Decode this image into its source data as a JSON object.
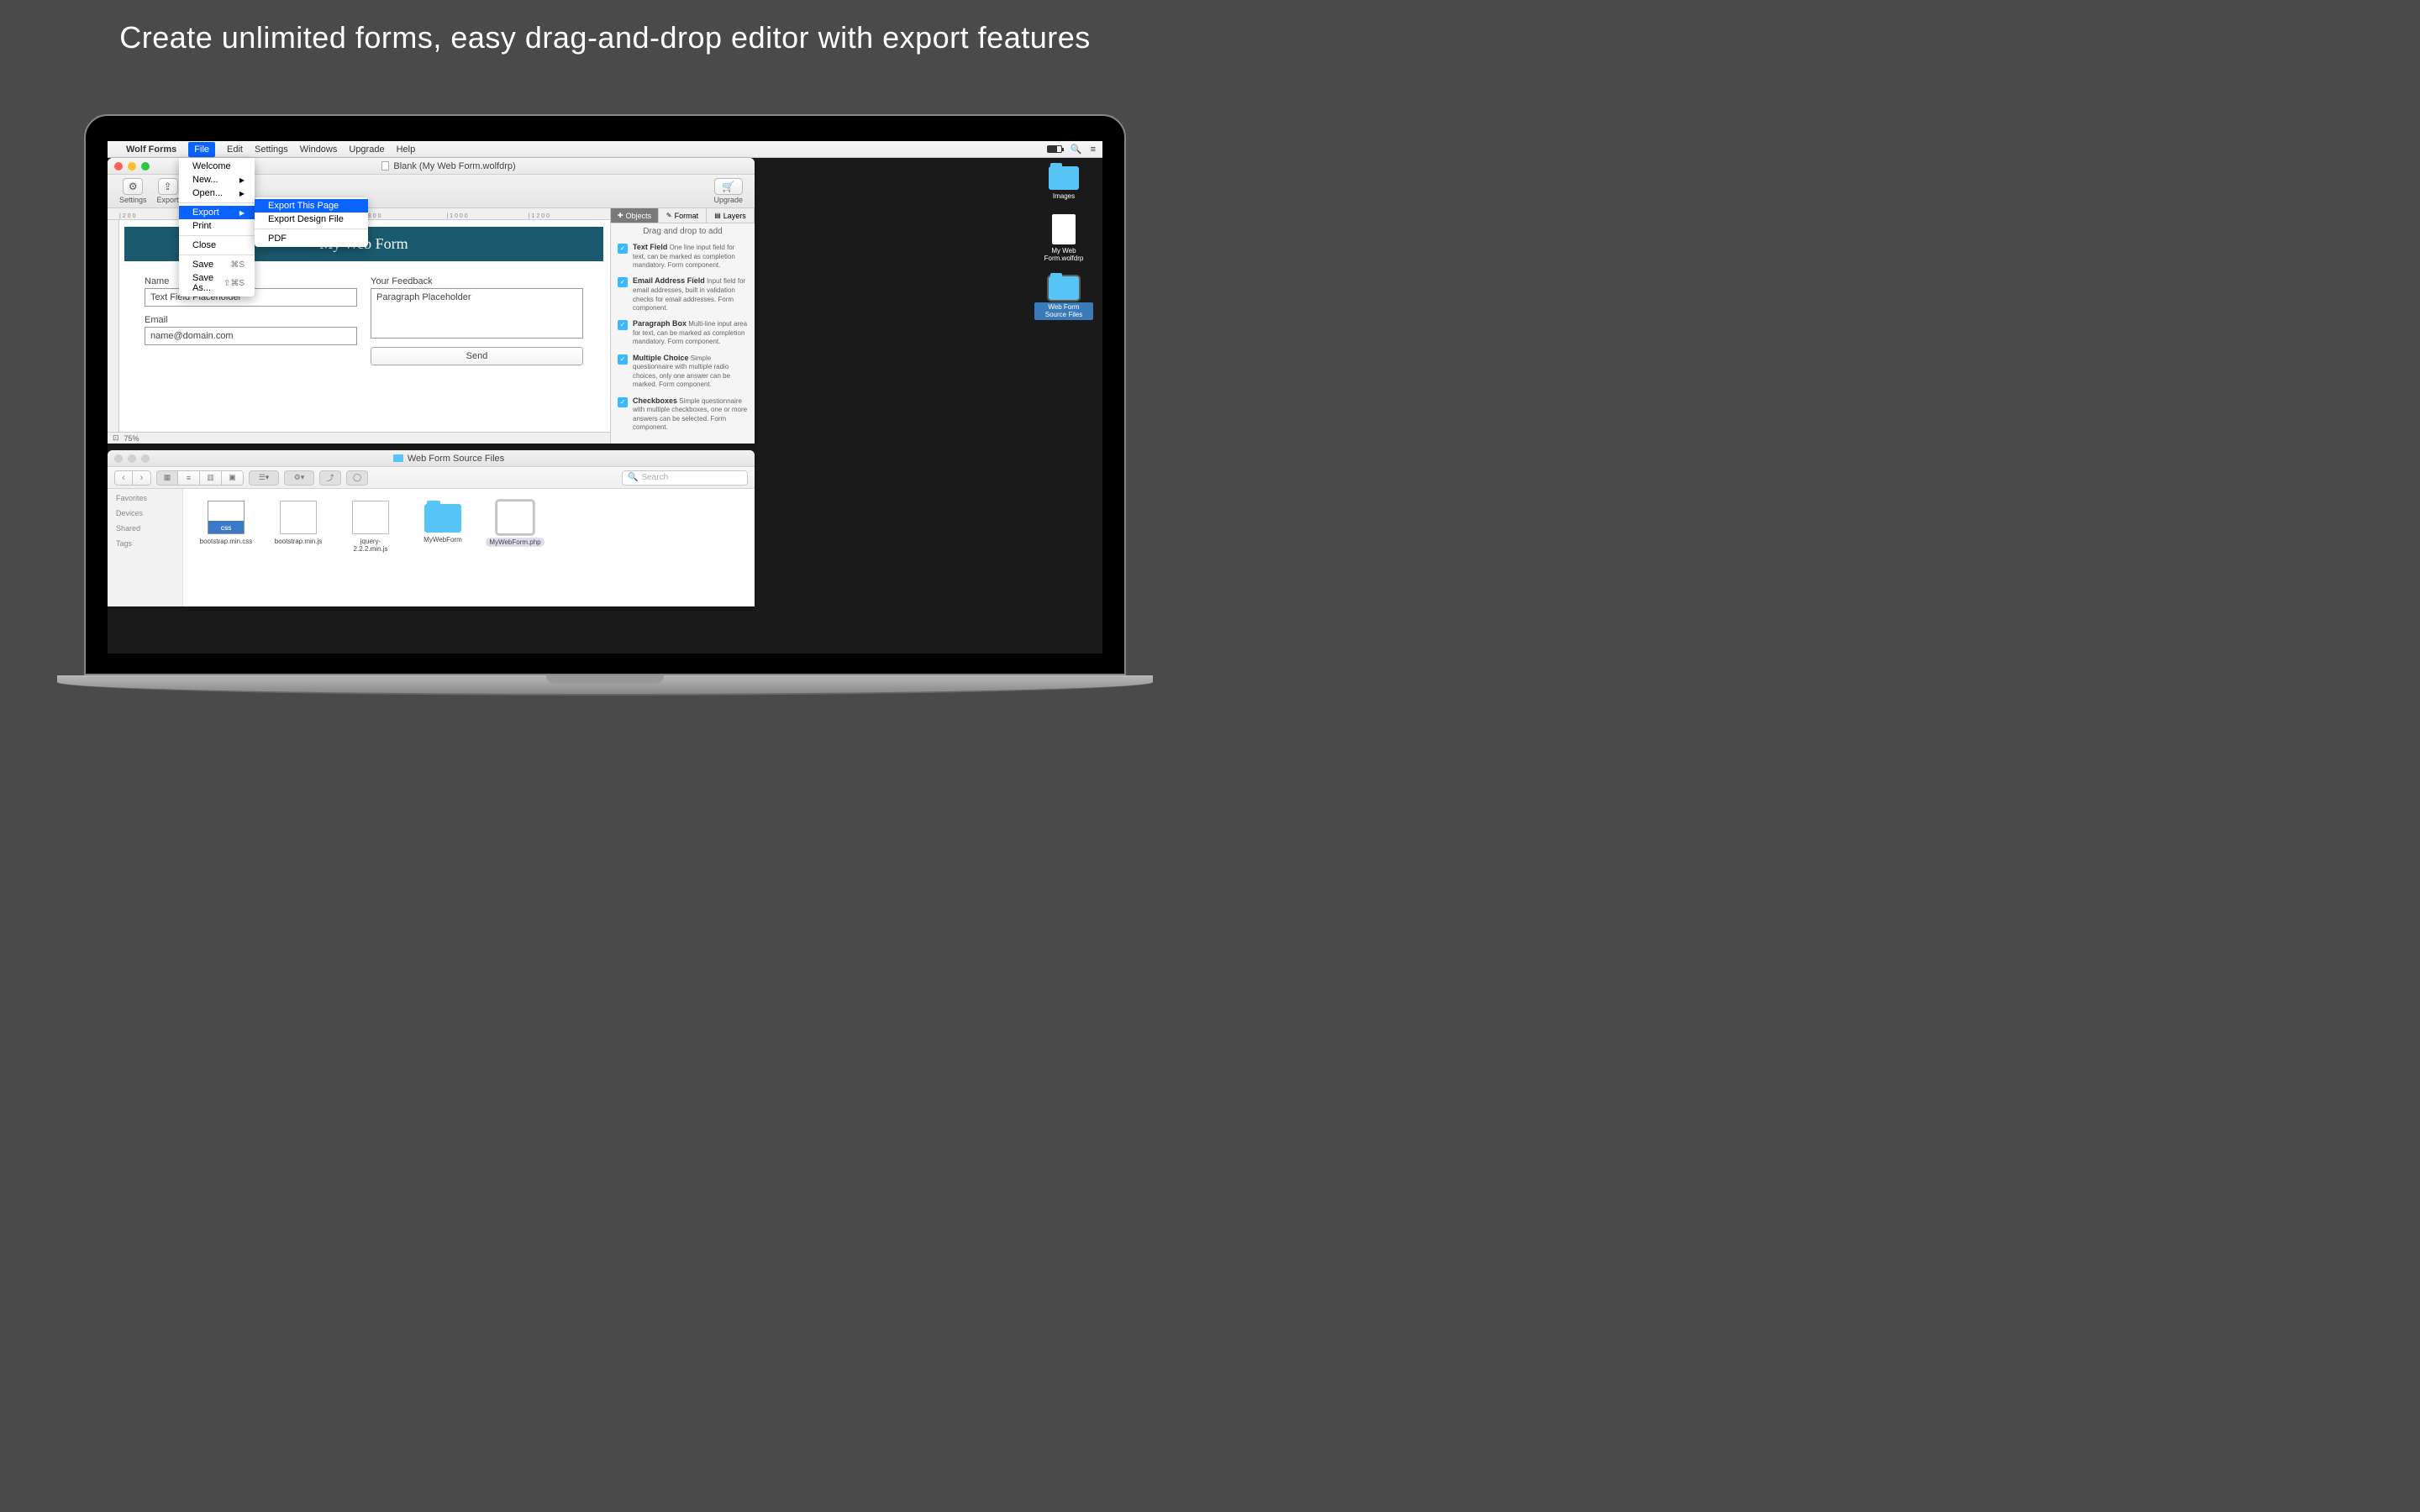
{
  "marketing": {
    "headline": "Create unlimited forms, easy drag-and-drop editor with export features"
  },
  "menubar": {
    "app_name": "Wolf Forms",
    "items": [
      "File",
      "Edit",
      "Settings",
      "Windows",
      "Upgrade",
      "Help"
    ]
  },
  "window": {
    "title": "Blank (My Web Form.wolfdrp)"
  },
  "toolbar": {
    "settings": "Settings",
    "export": "Export",
    "upgrade": "Upgrade"
  },
  "file_menu": {
    "welcome": "Welcome",
    "new": "New...",
    "open": "Open...",
    "export": "Export",
    "print": "Print",
    "close": "Close",
    "save": "Save",
    "save_as": "Save As...",
    "save_key": "⌘S",
    "save_as_key": "⇧⌘S"
  },
  "export_submenu": {
    "export_page": "Export This Page",
    "export_design": "Export Design File",
    "pdf": "PDF"
  },
  "form": {
    "title": "My Web Form",
    "name_label": "Name",
    "name_placeholder": "Text Field Placeholder",
    "email_label": "Email",
    "email_placeholder": "name@domain.com",
    "feedback_label": "Your Feedback",
    "feedback_placeholder": "Paragraph Placeholder",
    "send_button": "Send"
  },
  "zoom": "75%",
  "inspector": {
    "tabs": {
      "objects": "Objects",
      "format": "Format",
      "layers": "Layers"
    },
    "hint": "Drag and drop to add",
    "items": [
      {
        "title": "Text Field",
        "desc": "One line input field for text, can be marked as completion mandatory.  Form component."
      },
      {
        "title": "Email Address Field",
        "desc": "Input field for email addresses, built in validation checks for email addresses.  Form component."
      },
      {
        "title": "Paragraph Box",
        "desc": "Multi-line input area for text, can be marked as completion mandatory.  Form component."
      },
      {
        "title": "Multiple Choice",
        "desc": "Simple questionnaire with multiple radio choices, only one answer can be marked.  Form component."
      },
      {
        "title": "Checkboxes",
        "desc": "Simple questionnaire with multiple checkboxes, one or more answers can be selected.  Form component."
      }
    ]
  },
  "desktop": {
    "images": "Images",
    "webform": "My Web Form.wolfdrp",
    "sourcefiles": "Web Form Source Files"
  },
  "finder": {
    "title": "Web Form Source Files",
    "search_placeholder": "Search",
    "sidebar": {
      "favorites": "Favorites",
      "devices": "Devices",
      "shared": "Shared",
      "tags": "Tags"
    },
    "files": [
      "bootstrap.min.css",
      "bootstrap.min.js",
      "jquery-2.2.2.min.js",
      "MyWebForm",
      "MyWebForm.php"
    ]
  }
}
